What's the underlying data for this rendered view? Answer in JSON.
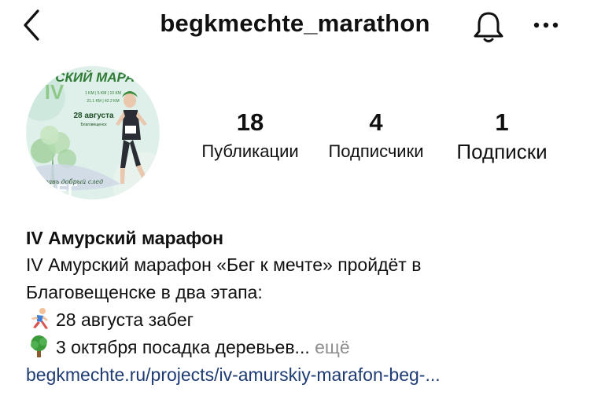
{
  "header": {
    "username": "begkmechte_marathon",
    "back_icon": "chevron-left-icon",
    "bell_icon": "bell-icon",
    "more_icon": "ellipsis-icon"
  },
  "avatar": {
    "title_text": "РСКИЙ МАРА",
    "roman": "IV",
    "distances_row1": "1 KM | 5 KM | 10 KM",
    "distances_row2": "21.1 KM | 42.2 KM",
    "date": "28 августа",
    "city": "Благовещенск",
    "bottom_text": "БЕГ",
    "slogan": "Оставь добрый след",
    "colors": {
      "bg": "#dff0ea",
      "green": "#2f7a35",
      "light_green": "#8fc98a"
    }
  },
  "stats": [
    {
      "value": "18",
      "label": "Публикации"
    },
    {
      "value": "4",
      "label": "Подписчики"
    },
    {
      "value": "1",
      "label": "Подписки"
    }
  ],
  "bio": {
    "name": "IV Амурский марафон",
    "lines": [
      "IV Амурский марафон «Бег к мечте» пройдёт в",
      "Благовещенске в два этапа:"
    ],
    "event1": {
      "icon": "runner-emoji-icon",
      "text": "28 августа забег"
    },
    "event2": {
      "icon": "tree-emoji-icon",
      "text": "3 октября посадка деревьев...",
      "more": "ещё"
    },
    "link": "begkmechte.ru/projects/iv-amurskiy-marafon-beg-..."
  }
}
